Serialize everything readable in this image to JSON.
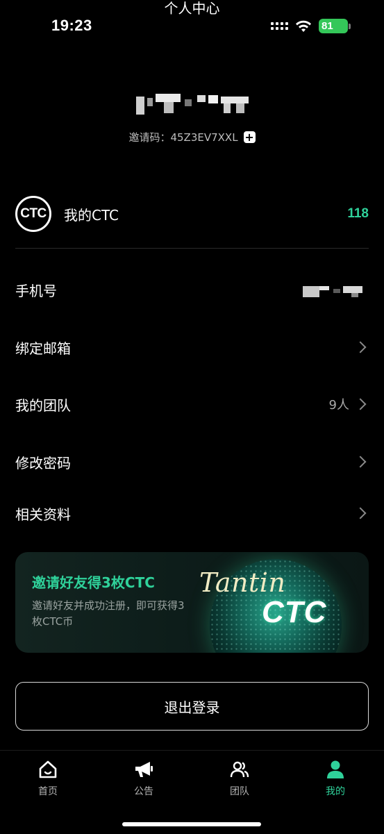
{
  "status_bar": {
    "time": "19:23",
    "battery": "81"
  },
  "header": {
    "title": "个人中心"
  },
  "profile": {
    "invite_label": "邀请码：",
    "invite_code": "45Z3EV7XXL"
  },
  "ctc": {
    "label": "我的CTC",
    "logo_text": "CTC",
    "value": "118"
  },
  "menu": {
    "phone": "手机号",
    "email": "绑定邮箱",
    "team": "我的团队",
    "team_count": "9人",
    "password": "修改密码",
    "docs": "相关资料"
  },
  "banner": {
    "title": "邀请好友得3枚CTC",
    "description": "邀请好友并成功注册，即可获得3枚CTC币",
    "brand_script": "Tantin",
    "brand_ctc": "CTC"
  },
  "logout": {
    "label": "退出登录"
  },
  "tabs": [
    {
      "label": "首页",
      "icon": "home-icon"
    },
    {
      "label": "公告",
      "icon": "megaphone-icon"
    },
    {
      "label": "团队",
      "icon": "team-icon"
    },
    {
      "label": "我的",
      "icon": "profile-icon"
    }
  ],
  "colors": {
    "accent": "#2fd19a",
    "background": "#000000"
  }
}
